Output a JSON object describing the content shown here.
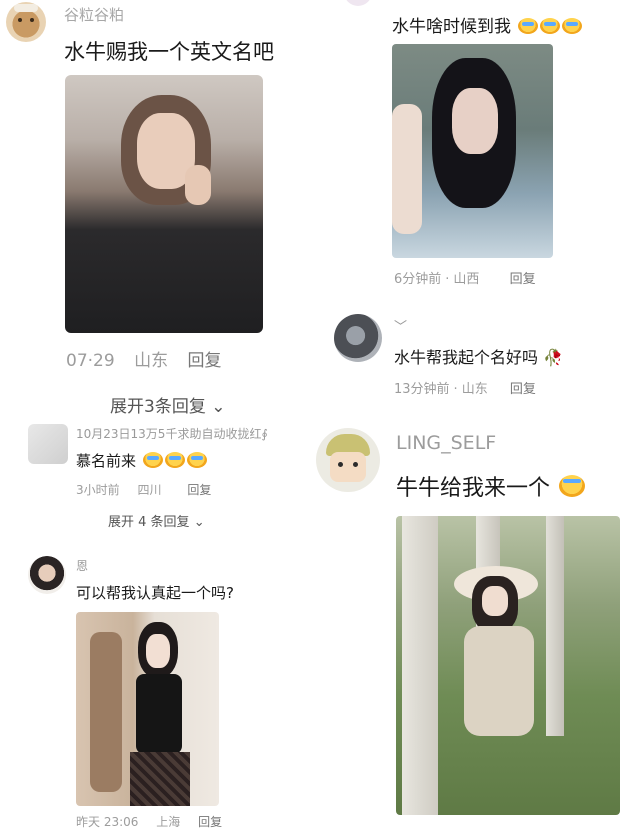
{
  "left": {
    "c1": {
      "username": "谷粒谷粕",
      "text": "水牛赐我一个英文名吧",
      "date": "07·29",
      "location": "山东",
      "reply": "回复",
      "expand": "展开3条回复"
    },
    "c2": {
      "username": "10月23日13万5千求助自动收拢红∮",
      "text": "慕名前来",
      "emoji_count": 3,
      "date": "3小时前",
      "location": "四川",
      "reply": "回复",
      "expand": "展开 4 条回复"
    },
    "c3": {
      "username": "恩",
      "text": "可以帮我认真起一个吗?",
      "date": "昨天 23:06",
      "location": "上海",
      "reply": "回复"
    }
  },
  "right": {
    "c1": {
      "text": "水牛啥时候到我",
      "emoji_count": 3,
      "date": "6分钟前",
      "location": "山西",
      "reply": "回复"
    },
    "c2": {
      "username": "﹀",
      "text": "水牛帮我起个名好吗",
      "date": "13分钟前",
      "location": "山东",
      "reply": "回复"
    },
    "c3": {
      "username": "LING_SELF",
      "text": "牛牛给我来一个"
    }
  },
  "colors": {
    "meta": "#9c9c9c",
    "text": "#1a1a1a",
    "background": "#ffffff"
  }
}
